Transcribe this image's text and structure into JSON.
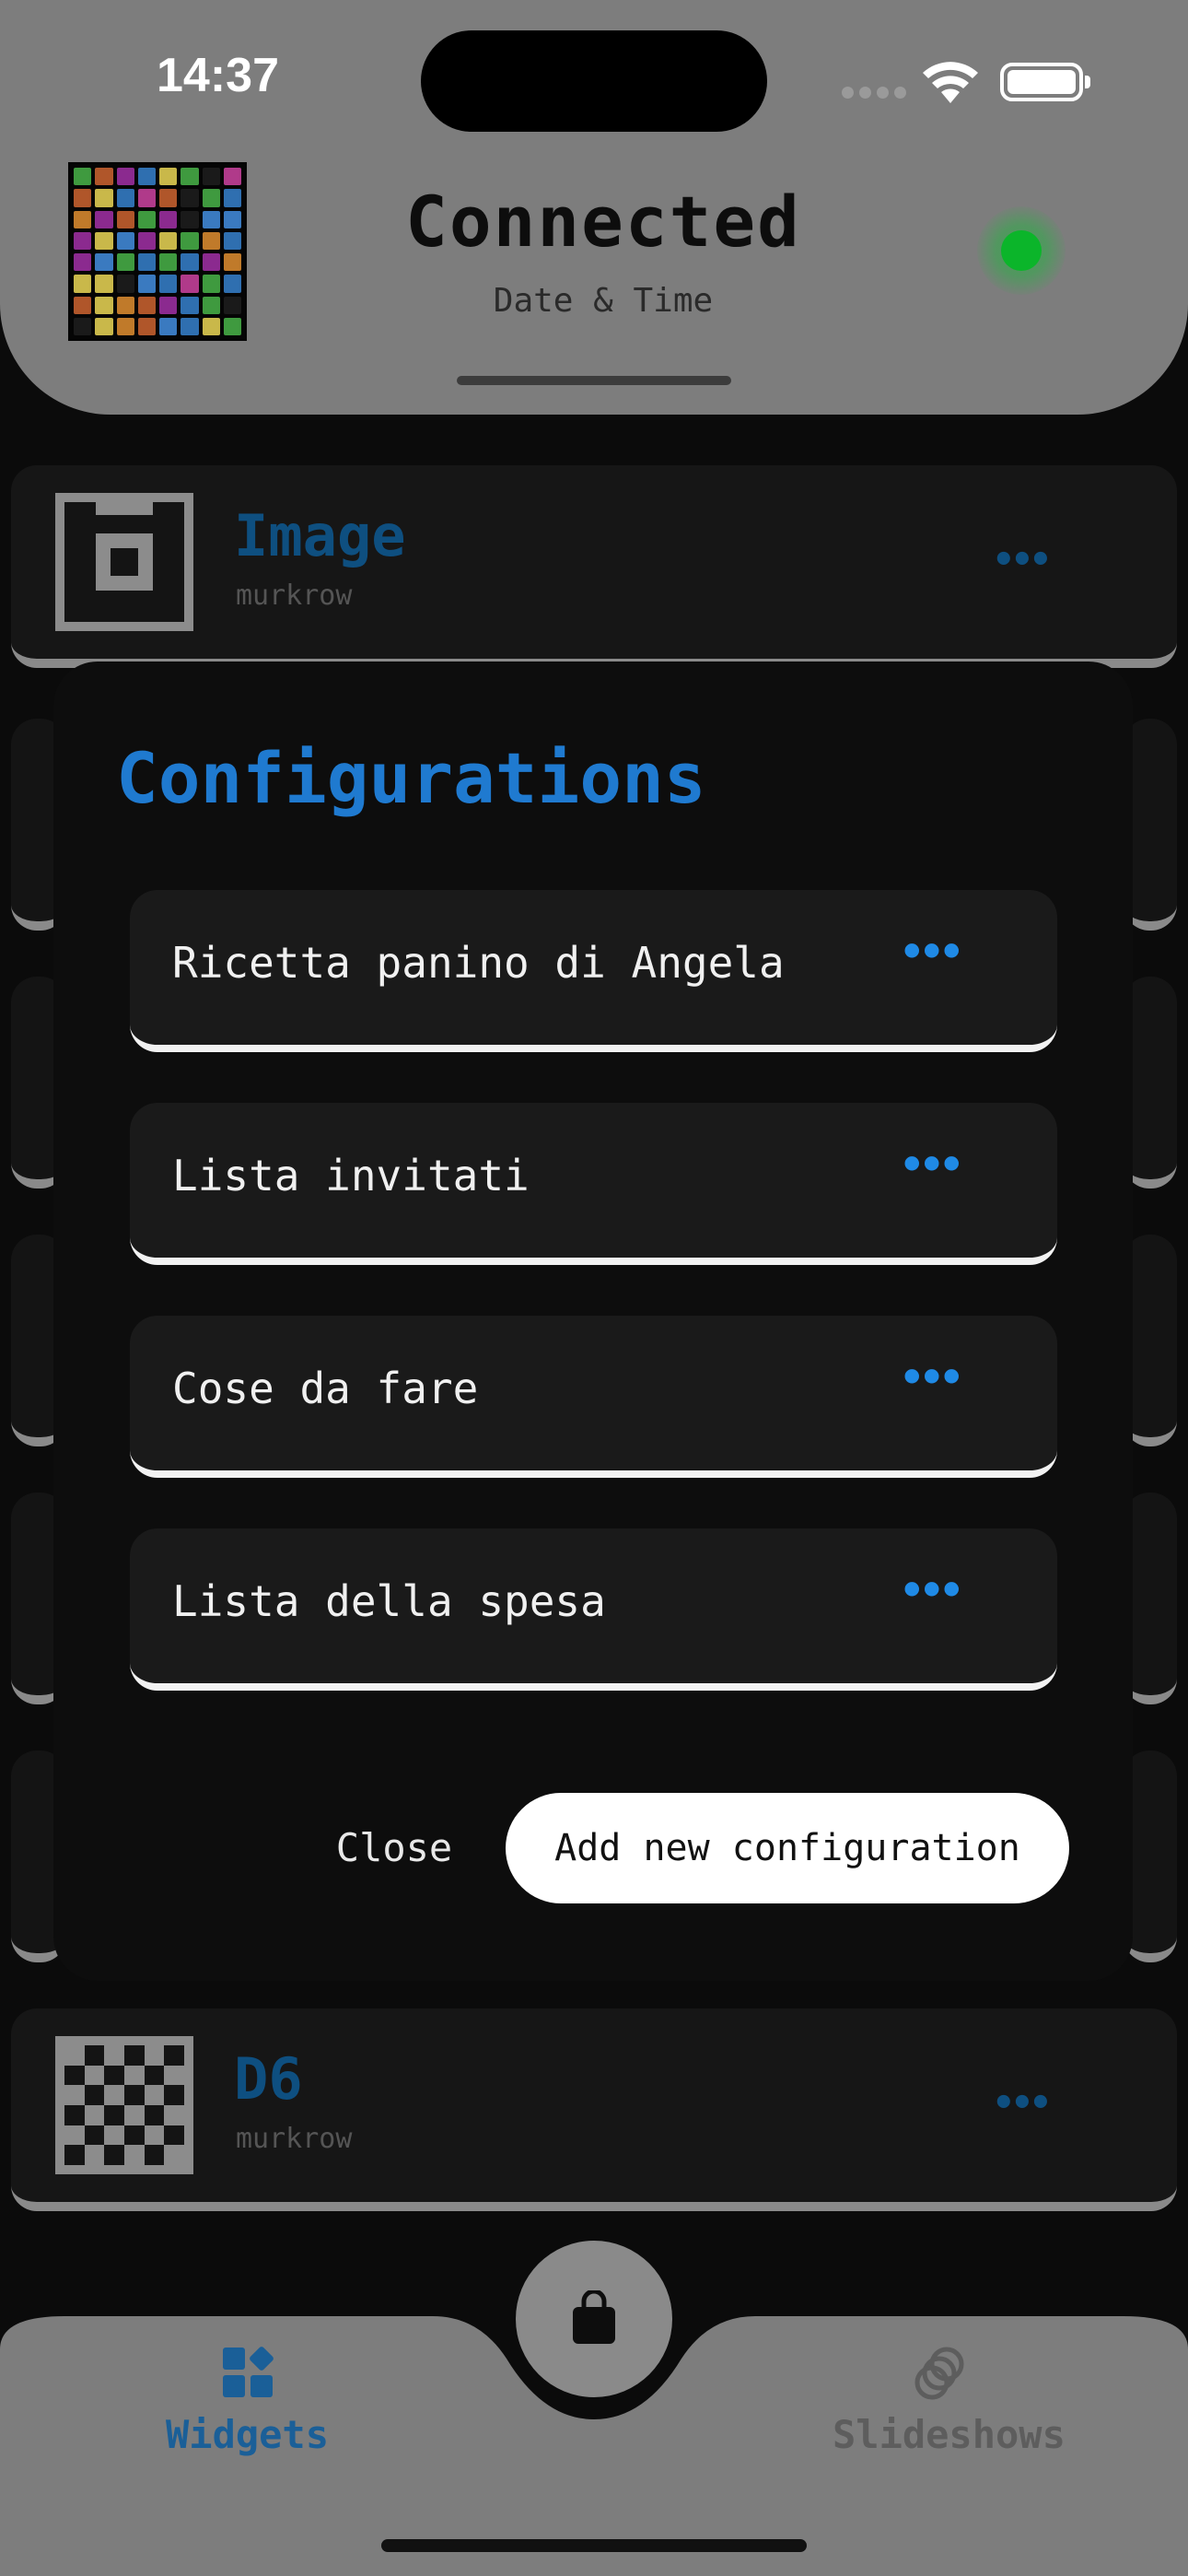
{
  "status_bar": {
    "time": "14:37"
  },
  "header": {
    "title": "Connected",
    "subtitle": "Date & Time",
    "status_color": "#0bb52a"
  },
  "widgets": [
    {
      "title": "Image",
      "author": "murkrow",
      "icon": "camera-icon"
    },
    {
      "title": "D6",
      "author": "murkrow",
      "icon": "checkerboard-icon"
    }
  ],
  "modal": {
    "title": "Configurations",
    "configurations": [
      {
        "label": "Ricetta panino di Angela",
        "more": "•••"
      },
      {
        "label": "Lista invitati",
        "more": "•••"
      },
      {
        "label": "Cose da fare",
        "more": "•••"
      },
      {
        "label": "Lista della spesa",
        "more": "•••"
      }
    ],
    "close_label": "Close",
    "add_label": "Add new configuration"
  },
  "tabbar": {
    "widgets_label": "Widgets",
    "slideshows_label": "Slideshows",
    "store_icon": "shopping-bag-icon"
  },
  "colors": {
    "accent": "#1f7ad0",
    "header_bg": "#7d7d7d",
    "modal_bg": "#0d0d0d"
  },
  "more_glyph": "•••"
}
